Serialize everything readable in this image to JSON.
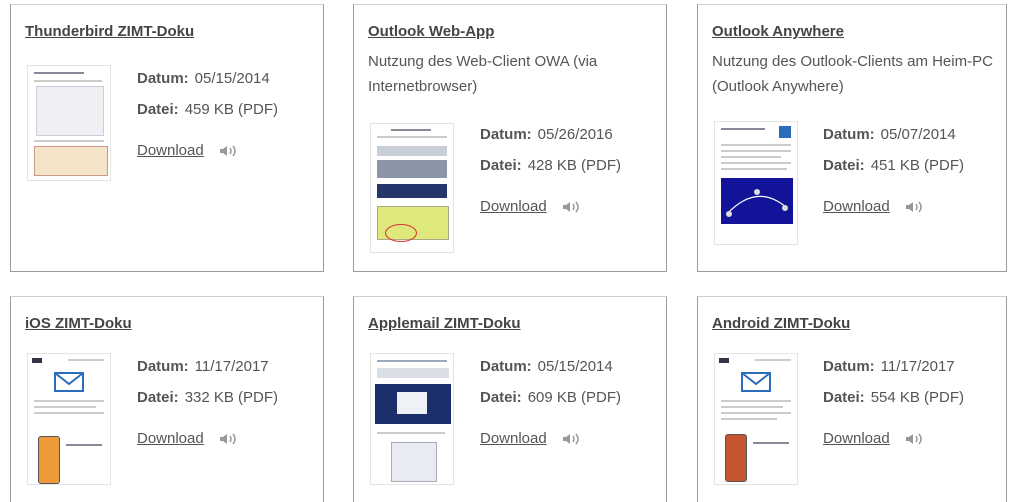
{
  "cards": [
    {
      "title": "Thunderbird ZIMT-Doku",
      "description": "",
      "date_label": "Datum:",
      "date": "05/15/2014",
      "file_label": "Datei:",
      "file": "459 KB (PDF)",
      "download_label": "Download",
      "speaker_icon": "speaker-icon"
    },
    {
      "title": "Outlook Web-App",
      "description": "Nutzung des Web-Client OWA (via Internetbrowser)",
      "date_label": "Datum:",
      "date": "05/26/2016",
      "file_label": "Datei:",
      "file": "428 KB (PDF)",
      "download_label": "Download",
      "speaker_icon": "speaker-icon"
    },
    {
      "title": "Outlook Anywhere",
      "description": "Nutzung des Outlook-Clients am Heim-PC (Outlook Anywhere)",
      "date_label": "Datum:",
      "date": "05/07/2014",
      "file_label": "Datei:",
      "file": "451 KB (PDF)",
      "download_label": "Download",
      "speaker_icon": "speaker-icon"
    },
    {
      "title": "iOS ZIMT-Doku",
      "description": "",
      "date_label": "Datum:",
      "date": "11/17/2017",
      "file_label": "Datei:",
      "file": "332 KB (PDF)",
      "download_label": "Download",
      "speaker_icon": "speaker-icon"
    },
    {
      "title": "Applemail ZIMT-Doku",
      "description": "",
      "date_label": "Datum:",
      "date": "05/15/2014",
      "file_label": "Datei:",
      "file": "609 KB (PDF)",
      "download_label": "Download",
      "speaker_icon": "speaker-icon"
    },
    {
      "title": "Android ZIMT-Doku",
      "description": "",
      "date_label": "Datum:",
      "date": "11/17/2017",
      "file_label": "Datei:",
      "file": "554 KB (PDF)",
      "download_label": "Download",
      "speaker_icon": "speaker-icon"
    }
  ],
  "colors": {
    "card_border": "#9a9a9a",
    "text": "#555555",
    "title": "#444444",
    "mail_icon_blue": "#2a6ebb"
  }
}
